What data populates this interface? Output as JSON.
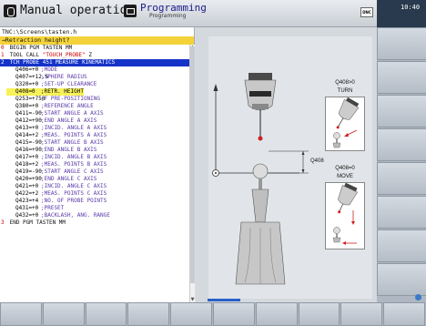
{
  "header": {
    "mode_left": "Manual operation",
    "mode_right": "Programming",
    "mode_right_sub": "Programming",
    "dnc": "DNC",
    "clock": "10:40"
  },
  "editor": {
    "path": "TNC:\\Screens\\tasten.h",
    "hint": "→Retraction height?",
    "lines": [
      {
        "num": "0",
        "text": " BEGIN PGM TASTEN MM"
      },
      {
        "num": "1",
        "text": " TOOL CALL ",
        "str": "\"TOUCH_PROBE\"",
        "tail": " Z"
      },
      {
        "num": "2",
        "text": " TCH PROBE 451 MEASURE KINEMATICS"
      }
    ],
    "params": [
      {
        "q": "Q406=+0",
        "c": ";MODE"
      },
      {
        "q": "Q407=+12.5",
        "c": ";SPHERE RADIUS"
      },
      {
        "q": "Q320=+0",
        "c": ";SET-UP CLEARANCE"
      },
      {
        "q": "Q408=0",
        "c": ";RETR. HEIGHT"
      },
      {
        "q": "Q253=+750",
        "c": ";F PRE-POSITIONING"
      },
      {
        "q": "Q380=+0",
        "c": ";REFERENCE ANGLE"
      },
      {
        "q": "Q411=-90",
        "c": ";START ANGLE A AXIS"
      },
      {
        "q": "Q412=+90",
        "c": ";END ANGLE A AXIS"
      },
      {
        "q": "Q413=+0",
        "c": ";INCID. ANGLE A AXIS"
      },
      {
        "q": "Q414=+2",
        "c": ";MEAS. POINTS A AXIS"
      },
      {
        "q": "Q415=-90",
        "c": ";START ANGLE B AXIS"
      },
      {
        "q": "Q416=+90",
        "c": ";END ANGLE B AXIS"
      },
      {
        "q": "Q417=+0",
        "c": ";INCID. ANGLE B AXIS"
      },
      {
        "q": "Q418=+2",
        "c": ";MEAS. POINTS B AXIS"
      },
      {
        "q": "Q419=-90",
        "c": ";START ANGLE C AXIS"
      },
      {
        "q": "Q420=+90",
        "c": ";END ANGLE C AXIS"
      },
      {
        "q": "Q421=+0",
        "c": ";INCID. ANGLE C AXIS"
      },
      {
        "q": "Q422=+2",
        "c": ";MEAS. POINTS C AXIS"
      },
      {
        "q": "Q423=+4",
        "c": ";NO. OF PROBE POINTS"
      },
      {
        "q": "Q431=+0",
        "c": ";PRESET"
      },
      {
        "q": "Q432=+0",
        "c": ";BACKLASH, ANG. RANGE"
      }
    ],
    "end_line": {
      "num": "3",
      "text": " END PGM TASTEN MM"
    }
  },
  "graphic": {
    "q408_label": "Q408",
    "turn_caption_1": "Q408>0",
    "turn_caption_2": "TURN",
    "move_caption_1": "Q408=0",
    "move_caption_2": "MOVE"
  },
  "colors": {
    "selected_line": "#1533c8",
    "hint_bar": "#f4d33a",
    "cursor": "#f7f25a"
  }
}
